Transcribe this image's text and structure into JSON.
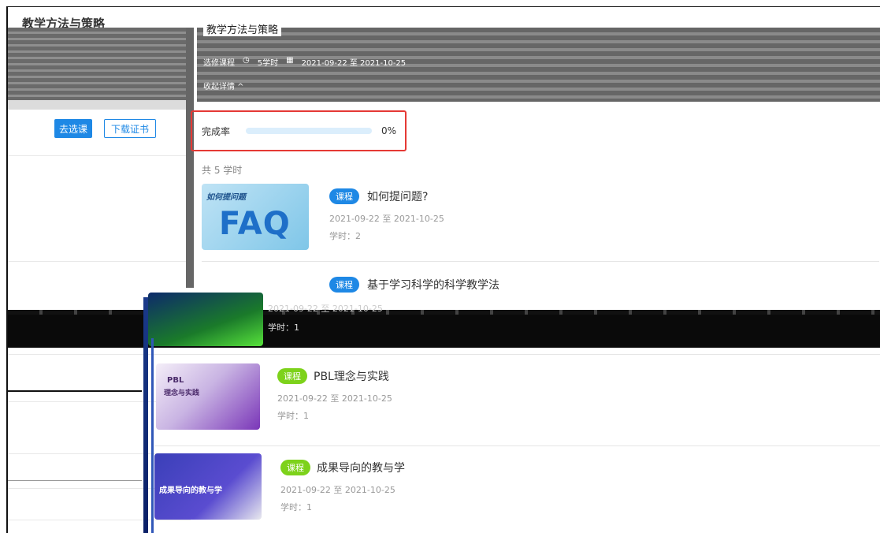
{
  "left": {
    "title": "教学方法与策略",
    "go_select_label": "去选课",
    "download_cert_label": "下载证书"
  },
  "header": {
    "title": "教学方法与策略",
    "meta": {
      "tag": "选修课程",
      "hours": "5学时",
      "date_range": "2021-09-22 至 2021-10-25"
    },
    "collapse_link": "收起详情 ^"
  },
  "completion": {
    "label": "完成率",
    "percent_text": "0%",
    "value": 0
  },
  "total_hours": "共 5 学时",
  "colors": {
    "accent": "#1e88e5",
    "tag_blue": "#1e88e5",
    "tag_green": "#7dd21b",
    "highlight_border": "#e53935",
    "progress_track": "#dbeefc"
  },
  "courses": [
    {
      "tag": "课程",
      "title": "如何提问题?",
      "date": "2021-09-22 至 2021-10-25",
      "hours": "学时：2",
      "thumb_text": "FAQ",
      "thumb_caption": "如何提问题"
    },
    {
      "tag": "课程",
      "title": "基于学习科学的科学教学法",
      "date": "2021-09-22 至 2021-10-25",
      "hours": "学时：1"
    },
    {
      "tag": "课程",
      "title": "PBL理念与实践",
      "date": "2021-09-22 至 2021-10-25",
      "hours": "学时：1",
      "thumb_text": "PBL",
      "thumb_caption": "理念与实践"
    },
    {
      "tag": "课程",
      "title": "成果导向的教与学",
      "date": "2021-09-22 至 2021-10-25",
      "hours": "学时：1",
      "thumb_text": "成果导向的教与学"
    }
  ]
}
